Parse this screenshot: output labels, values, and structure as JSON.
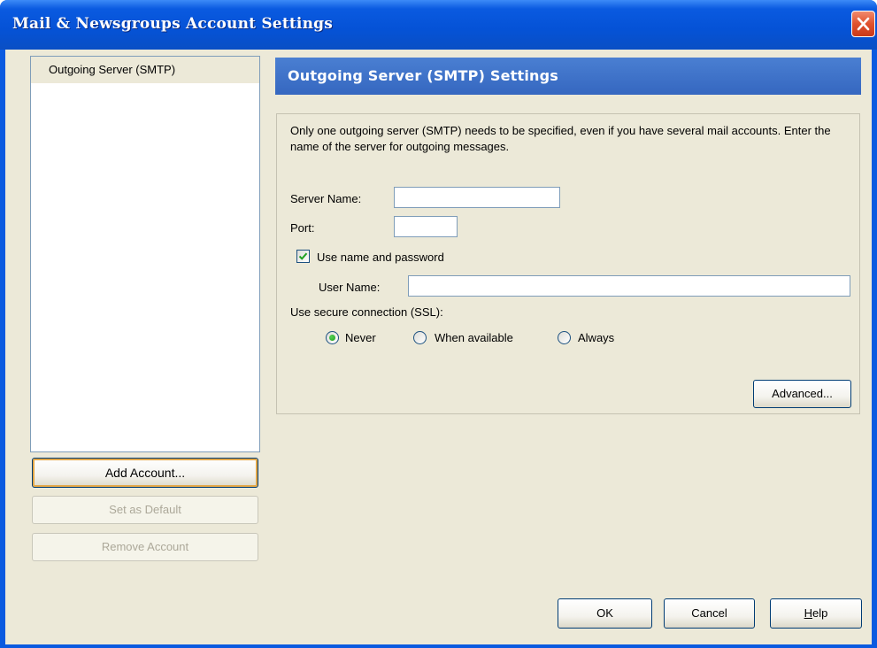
{
  "window": {
    "title": "Mail & Newsgroups Account Settings"
  },
  "sidebar": {
    "items": [
      {
        "label": "Outgoing Server (SMTP)",
        "selected": true
      }
    ],
    "buttons": {
      "add_account": "Add Account...",
      "set_default": "Set as Default",
      "remove_account": "Remove Account"
    }
  },
  "panel": {
    "title": "Outgoing Server (SMTP) Settings",
    "description": "Only one outgoing server (SMTP) needs to be specified, even if you have several mail accounts. Enter the name of the server for outgoing messages.",
    "server_name": {
      "label": "Server Name:",
      "value": ""
    },
    "port": {
      "label": "Port:",
      "value": ""
    },
    "use_name_password": {
      "label": "Use name and password",
      "checked": true
    },
    "user_name": {
      "label": "User Name:",
      "value": ""
    },
    "ssl": {
      "label": "Use secure connection (SSL):",
      "options": [
        {
          "label": "Never",
          "selected": true
        },
        {
          "label": "When available",
          "selected": false
        },
        {
          "label": "Always",
          "selected": false
        }
      ]
    },
    "advanced_label": "Advanced..."
  },
  "footer": {
    "ok": "OK",
    "cancel": "Cancel",
    "help": "Help"
  },
  "colors": {
    "titlebar": "#0a5ae0",
    "panel_header": "#3567c0",
    "dialog_bg": "#ece9d8",
    "close_button": "#e0512d"
  },
  "icons": {
    "close": "close-x-icon",
    "checkbox": "checkmark-icon"
  }
}
